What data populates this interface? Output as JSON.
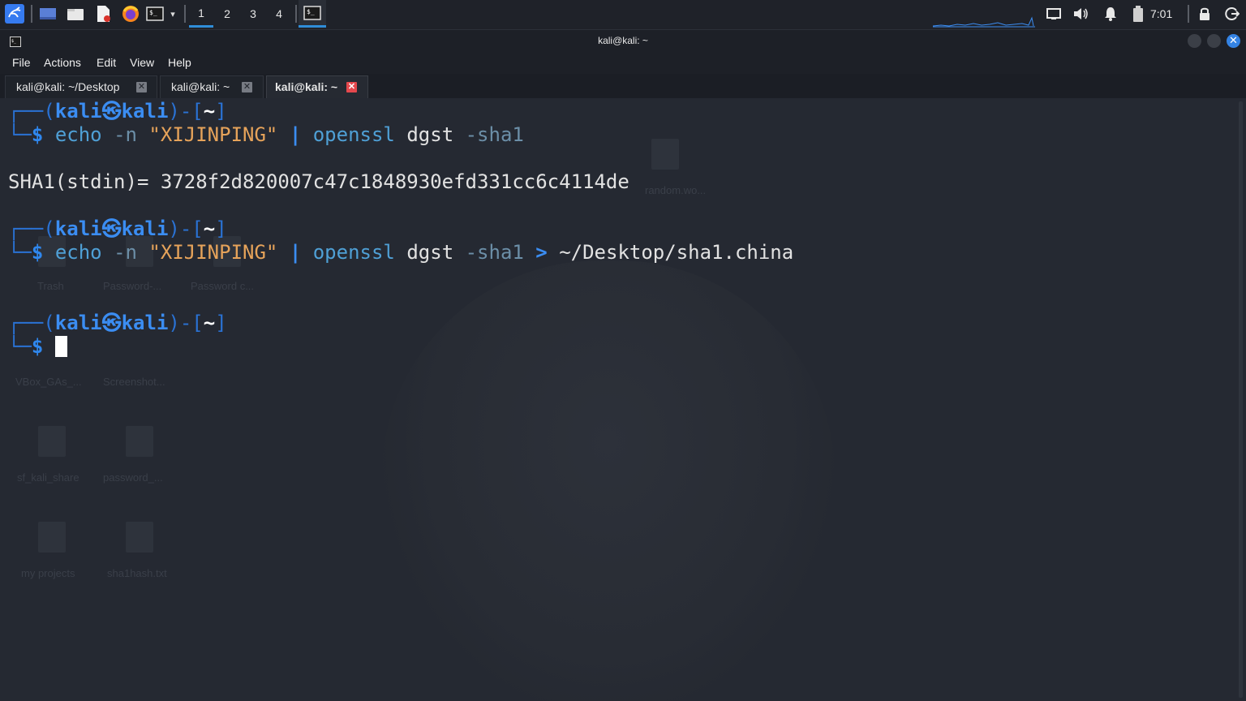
{
  "panel": {
    "workspaces": [
      "1",
      "2",
      "3",
      "4"
    ],
    "active_workspace": "1",
    "clock": "7:01",
    "icons": [
      "kali-menu-icon",
      "show-desktop-icon",
      "file-manager-icon",
      "text-editor-icon",
      "firefox-icon",
      "terminal-launcher-icon",
      "chevron-down-icon",
      "terminal-task-icon",
      "display-icon",
      "volume-icon",
      "notification-bell-icon",
      "battery-icon",
      "lock-icon",
      "logout-icon"
    ]
  },
  "window": {
    "title": "kali@kali: ~",
    "menu": [
      "File",
      "Actions",
      "Edit",
      "View",
      "Help"
    ],
    "tabs": [
      {
        "label": "kali@kali: ~/Desktop",
        "active": false
      },
      {
        "label": "kali@kali: ~",
        "active": false
      },
      {
        "label": "kali@kali: ~",
        "active": true
      }
    ]
  },
  "terminal": {
    "prompt": {
      "frame_top": "┌──(",
      "user": "kali",
      "at": "㉿",
      "host": "kali",
      "mid": ")-[",
      "dir": "~",
      "end": "]",
      "frame_bottom": "└─",
      "dollar": "$"
    },
    "cmd1": {
      "echo": "echo",
      "flag": "-n",
      "string": "\"XIJINPING\"",
      "pipe": "|",
      "openssl": "openssl",
      "dgst": "dgst",
      "sha": "-sha1"
    },
    "output1": "SHA1(stdin)= 3728f2d820007c47c1848930efd331cc6c4114de",
    "cmd2": {
      "echo": "echo",
      "flag": "-n",
      "string": "\"XIJINPING\"",
      "pipe": "|",
      "openssl": "openssl",
      "dgst": "dgst",
      "sha": "-sha1",
      "redirect": ">",
      "path": "~/Desktop/sha1.china"
    }
  },
  "desktop_ghost": {
    "labels": [
      "Trash",
      "Password-...",
      "Password c...",
      "VBox_GAs_...",
      "Screenshot...",
      "sf_kali_share",
      "password_...",
      "my projects",
      "sha1hash.txt",
      "random.wo..."
    ]
  },
  "colors": {
    "accent": "#2f8dd8",
    "close_tab": "#e5484d",
    "prompt_blue": "#3b8df2",
    "string_orange": "#e6a35a"
  }
}
